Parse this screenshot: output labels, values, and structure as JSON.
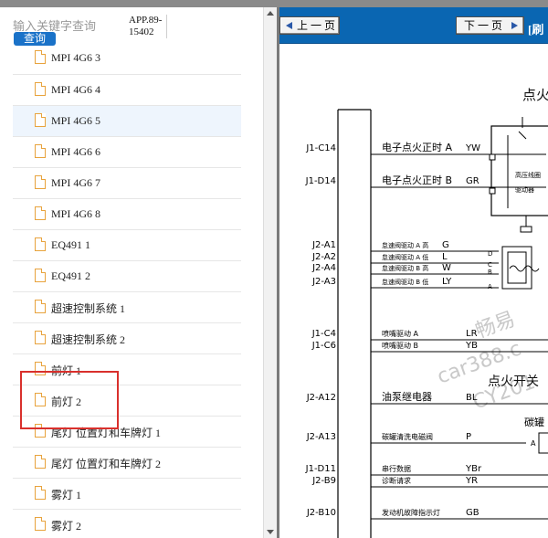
{
  "search": {
    "placeholder": "输入关键字查询",
    "button_label": "查询"
  },
  "app_code": [
    "APP.89-",
    "15402"
  ],
  "list_items": [
    {
      "label": "MPI 4G6 3"
    },
    {
      "label": "MPI 4G6 4"
    },
    {
      "label": "MPI 4G6 5",
      "selected": true
    },
    {
      "label": "MPI 4G6 6"
    },
    {
      "label": "MPI 4G6 7"
    },
    {
      "label": "MPI 4G6 8"
    },
    {
      "label": "EQ491 1"
    },
    {
      "label": "EQ491 2"
    },
    {
      "label": "超速控制系统 1"
    },
    {
      "label": "超速控制系统 2"
    },
    {
      "label": "前灯 1"
    },
    {
      "label": "前灯 2"
    },
    {
      "label": "尾灯 位置灯和车牌灯 1"
    },
    {
      "label": "尾灯 位置灯和车牌灯 2"
    },
    {
      "label": "雾灯 1"
    },
    {
      "label": "雾灯 2"
    }
  ],
  "viewer": {
    "prev_label": "上 一 页",
    "next_label": "下 一 页",
    "doc_title": "[刷",
    "toolbar_color": "#0a66b2"
  },
  "schematic": {
    "heading_top": "点火",
    "heading_mid": "点火开关",
    "module_label_1": "高压线圈",
    "module_label_2": "驱动器",
    "right_label": "碳罐",
    "connector_letters": [
      "D",
      "C",
      "B",
      "A"
    ],
    "corner_letter": "A",
    "pins": [
      {
        "pin": "J1-C14",
        "desc": "电子点火正时 A",
        "wire": "YW"
      },
      {
        "pin": "J1-D14",
        "desc": "电子点火正时 B",
        "wire": "GR"
      },
      {
        "pin": "J2-A1",
        "desc": "怠速阀驱动 A 高",
        "wire": "G"
      },
      {
        "pin": "J2-A2",
        "desc": "怠速阀驱动 A 低",
        "wire": "L"
      },
      {
        "pin": "J2-A4",
        "desc": "怠速阀驱动 B 高",
        "wire": "W"
      },
      {
        "pin": "J2-A3",
        "desc": "怠速阀驱动 B 低",
        "wire": "LY"
      },
      {
        "pin": "J1-C4",
        "desc": "喷嘴驱动 A",
        "wire": "LR"
      },
      {
        "pin": "J1-C6",
        "desc": "喷嘴驱动 B",
        "wire": "YB"
      },
      {
        "pin": "J2-A12",
        "desc": "油泵继电器",
        "wire": "BL"
      },
      {
        "pin": "J2-A13",
        "desc": "碳罐清洗电磁阀",
        "wire": "P"
      },
      {
        "pin": "J1-D11",
        "desc": "串行数据",
        "wire": "YBr"
      },
      {
        "pin": "J2-B9",
        "desc": "诊断请求",
        "wire": "YR"
      },
      {
        "pin": "J2-B10",
        "desc": "发动机故障指示灯",
        "wire": "GB"
      }
    ],
    "watermark": [
      "畅易",
      "car388.c",
      "CY201"
    ]
  }
}
